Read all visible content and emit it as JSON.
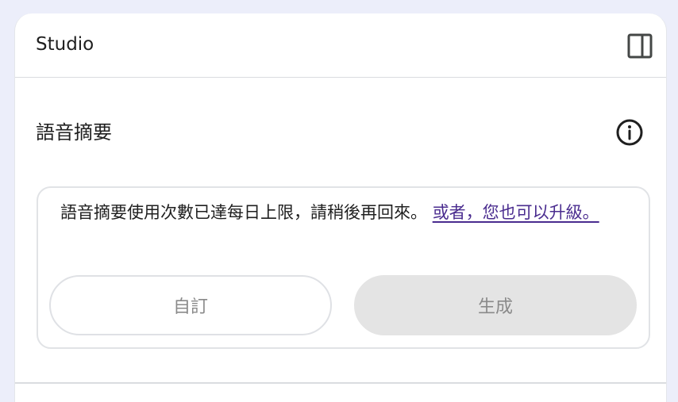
{
  "header": {
    "title": "Studio",
    "toggle_icon": "sidebar-panel-icon"
  },
  "audio_overview": {
    "title": "語音摘要",
    "info_icon": "info-icon",
    "message": "語音摘要使用次數已達每日上限，請稍後再回來。",
    "upgrade_link": "或者，您也可以升級。",
    "customize_label": "自訂",
    "generate_label": "生成"
  },
  "colors": {
    "background": "#eceefa",
    "link": "#4a2c8f",
    "disabled_text": "#8a8a8a",
    "disabled_fill": "#e4e4e4"
  }
}
